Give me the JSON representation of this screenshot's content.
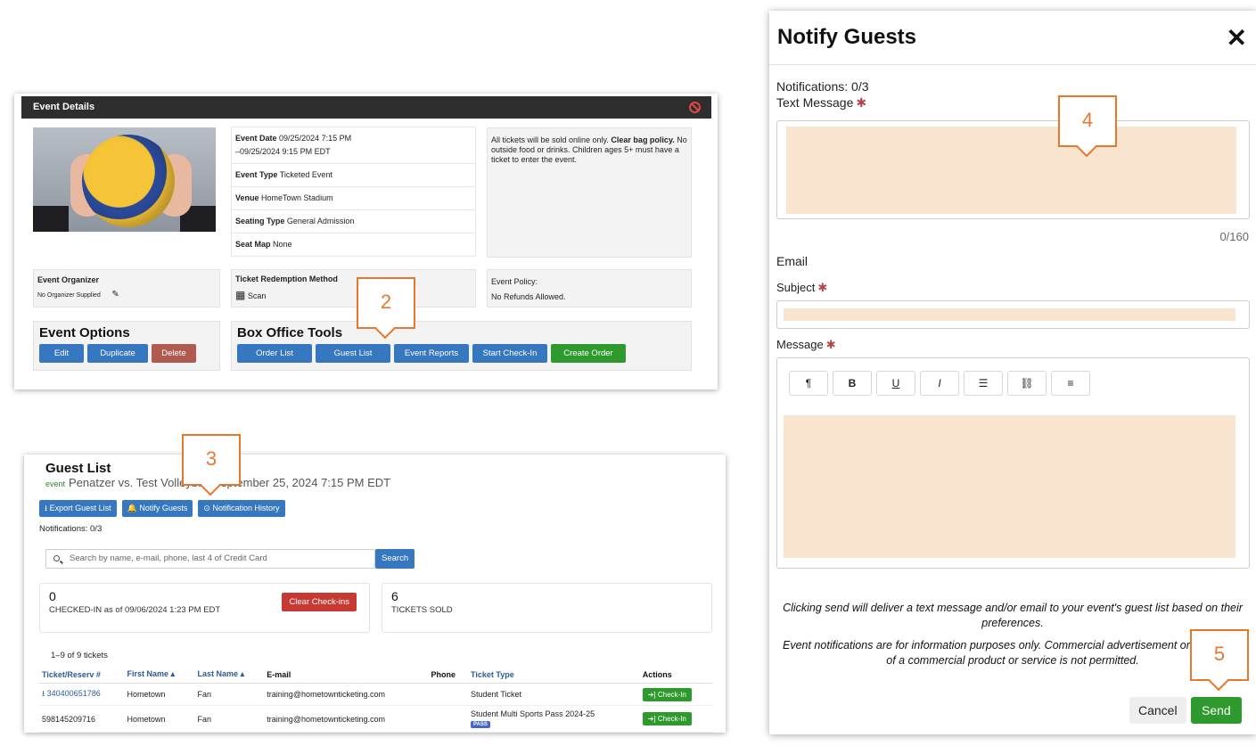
{
  "event_details": {
    "header": "Event Details",
    "event_date_label": "Event Date",
    "event_date_value": "09/25/2024 7:15 PM",
    "event_date_end": "–09/25/2024 9:15 PM EDT",
    "event_type_label": "Event Type",
    "event_type_value": "Ticketed Event",
    "venue_label": "Venue",
    "venue_value": "HomeTown Stadium",
    "seating_label": "Seating Type",
    "seating_value": "General Admission",
    "seatmap_label": "Seat Map",
    "seatmap_value": "None",
    "policy_text_1": "All tickets will be sold online only.",
    "policy_bold": "Clear bag policy.",
    "policy_text_2": "No outside food or drinks. Children ages 5+ must have a ticket to enter the event.",
    "organizer_label": "Event Organizer",
    "organizer_value": "No Organizer Supplied",
    "redemption_label": "Ticket Redemption Method",
    "redemption_value": "Scan",
    "event_policy_label": "Event Policy:",
    "event_policy_value": "No Refunds Allowed.",
    "options_title": "Event Options",
    "options_buttons": [
      "Edit",
      "Duplicate",
      "Delete"
    ],
    "box_office_title": "Box Office Tools",
    "box_office_buttons": [
      "Order List",
      "Guest List",
      "Event Reports",
      "Start Check-In",
      "Create Order"
    ]
  },
  "guest_list": {
    "title": "Guest List",
    "event_tag": "event",
    "event_name": "Penatzer vs. Test Volleyball September 25, 2024 7:15 PM EDT",
    "buttons": [
      "⭳ Export Guest List",
      "🔔 Notify Guests",
      "⊙ Notification History"
    ],
    "notifications": "Notifications: 0/3",
    "search_placeholder": "Search by name, e-mail, phone, last 4 of Credit Card",
    "search_button": "Search",
    "checked_in_count": "0",
    "checked_in_label": "CHECKED-IN as of 09/06/2024 1:23 PM EDT",
    "clear_button": "Clear Check-ins",
    "tickets_sold_count": "6",
    "tickets_sold_label": "TICKETS SOLD",
    "count_text": "1–9 of 9 tickets",
    "columns": [
      "Ticket/Reserv #",
      "First Name ▴",
      "Last Name ▴",
      "E-mail",
      "Phone",
      "Ticket Type",
      "Actions"
    ],
    "rows": [
      {
        "ticket": "⭳ 340400651786",
        "first": "Hometown",
        "last": "Fan",
        "email": "training@hometownticketing.com",
        "phone": "",
        "type": "Student Ticket",
        "action": "➔] Check-In"
      },
      {
        "ticket": "598145209716",
        "first": "Hometown",
        "last": "Fan",
        "email": "training@hometownticketing.com",
        "phone": "",
        "type": "Student Multi Sports Pass 2024-25",
        "badge": "PASS",
        "action": "➔] Check-In"
      }
    ]
  },
  "modal": {
    "title": "Notify Guests",
    "close": "✕",
    "notifications": "Notifications: 0/3",
    "text_message_label": "Text Message",
    "required_mark": "✱",
    "counter": "0/160",
    "email_label": "Email",
    "subject_label": "Subject",
    "message_label": "Message",
    "toolbar": [
      "¶",
      "B",
      "U",
      "I",
      "☰",
      "⛓",
      "≡"
    ],
    "note_1": "Clicking send will deliver a text message and/or email to your event's guest list based on their preferences.",
    "note_2": "Event notifications are for information purposes only. Commercial advertisement or promotion of a commercial product or service is not permitted.",
    "cancel": "Cancel",
    "send": "Send"
  },
  "callouts": [
    "2",
    "3",
    "4",
    "5"
  ],
  "colors": {
    "accent": "#e8772e",
    "primary": "#3677c0",
    "success": "#2e9a2e",
    "danger": "#c63a33",
    "field_fill": "#f8e4cf"
  }
}
